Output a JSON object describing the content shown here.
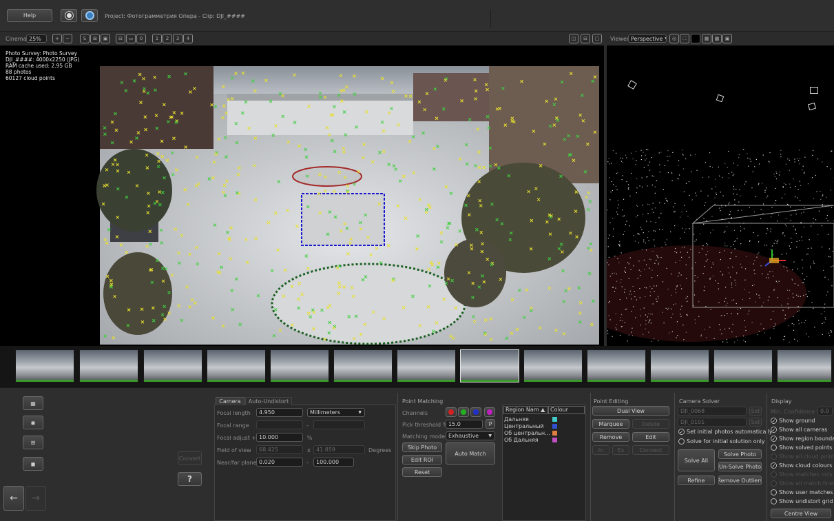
{
  "topbar": {
    "help": "Help",
    "project": "Project: Фотограмметрия Опера - Clip: DJI_####"
  },
  "cinema": {
    "label": "Cinema",
    "zoom": "25%",
    "view_nums": [
      "1",
      "2",
      "3",
      "4"
    ]
  },
  "viewer": {
    "label": "Viewer",
    "mode": "Perspective"
  },
  "overlay": {
    "lines": [
      "Photo Survey: Photo Survey",
      "DJI_####: 4000x2250 (JPG)",
      "RAM cache used: 2.95 GB",
      "88 photos",
      "60127 cloud points"
    ]
  },
  "camera_panel": {
    "tabs": [
      "Camera",
      "Auto-Undistort"
    ],
    "focal_length_label": "Focal length",
    "focal_length": "4.950",
    "units": "Millimeters",
    "focal_range_label": "Focal range",
    "focal_range_dash": "-",
    "focal_adjust_label": "Focal adjust +/-",
    "focal_adjust": "10.000",
    "percent": "%",
    "fov_label": "Field of view",
    "fov_w": "68.425",
    "x": "x",
    "fov_h": "41.859",
    "degrees": "Degrees",
    "near_far_label": "Near/far planes",
    "near": "0.020",
    "dash": "-",
    "far": "100.000",
    "convert": "Convert",
    "help_icon": "?"
  },
  "point_matching": {
    "title": "Point Matching",
    "channels_label": "Channels",
    "pick_threshold_label": "Pick threshold %",
    "pick_threshold": "15.0",
    "pick_btn": "P",
    "matching_mode_label": "Matching mode",
    "matching_mode": "Exhaustive",
    "skip_photo": "Skip Photo",
    "edit_roi": "Edit ROI",
    "reset": "Reset",
    "auto_match": "Auto Match",
    "channel_colors": [
      "#d42020",
      "#20b020",
      "#2030c8",
      "#c020c0"
    ]
  },
  "regions": {
    "col_name": "Region Nam ▲",
    "col_colour": "Colour",
    "rows": [
      {
        "name": "Дальняя",
        "color": "#40c8c8"
      },
      {
        "name": "Центральный",
        "color": "#3050d0"
      },
      {
        "name": "Об центральн...",
        "color": "#e08040"
      },
      {
        "name": "Об Дальняя",
        "color": "#c050c0"
      }
    ]
  },
  "point_editing": {
    "title": "Point Editing",
    "dual_view": "Dual View",
    "marquee": "Marquee",
    "delete": "Delete",
    "remove": "Remove",
    "edit": "Edit",
    "b1": "In",
    "b2": "Ex",
    "connect": "Connect"
  },
  "camera_solver": {
    "title": "Camera Solver",
    "cam1": "DJI_0068",
    "cam2": "DJI_0101",
    "set": "Set",
    "set_initial": "Set initial photos automatically",
    "solve_initial": "Solve for initial solution only",
    "solve_all": "Solve All",
    "solve_photo": "Solve Photo",
    "unsolve_photo": "Un-Solve Photo",
    "refine": "Refine",
    "remove_outliers": "Remove Outliers"
  },
  "display": {
    "title": "Display",
    "min_conf_label": "Min. Confidence %",
    "min_conf": "0.0",
    "options": [
      {
        "label": "Show ground",
        "on": true,
        "enabled": true
      },
      {
        "label": "Show all cameras",
        "on": true,
        "enabled": true
      },
      {
        "label": "Show region boundaries",
        "on": true,
        "enabled": true
      },
      {
        "label": "Show solved points",
        "on": false,
        "enabled": true
      },
      {
        "label": "Show all cloud points",
        "on": false,
        "enabled": false
      },
      {
        "label": "Show cloud colours",
        "on": true,
        "enabled": true
      },
      {
        "label": "Show matches only",
        "on": false,
        "enabled": false
      },
      {
        "label": "Show all match lines",
        "on": false,
        "enabled": false
      },
      {
        "label": "Show user matches only",
        "on": false,
        "enabled": true
      },
      {
        "label": "Show undistort grid",
        "on": false,
        "enabled": true
      }
    ],
    "centre_view": "Centre View"
  }
}
